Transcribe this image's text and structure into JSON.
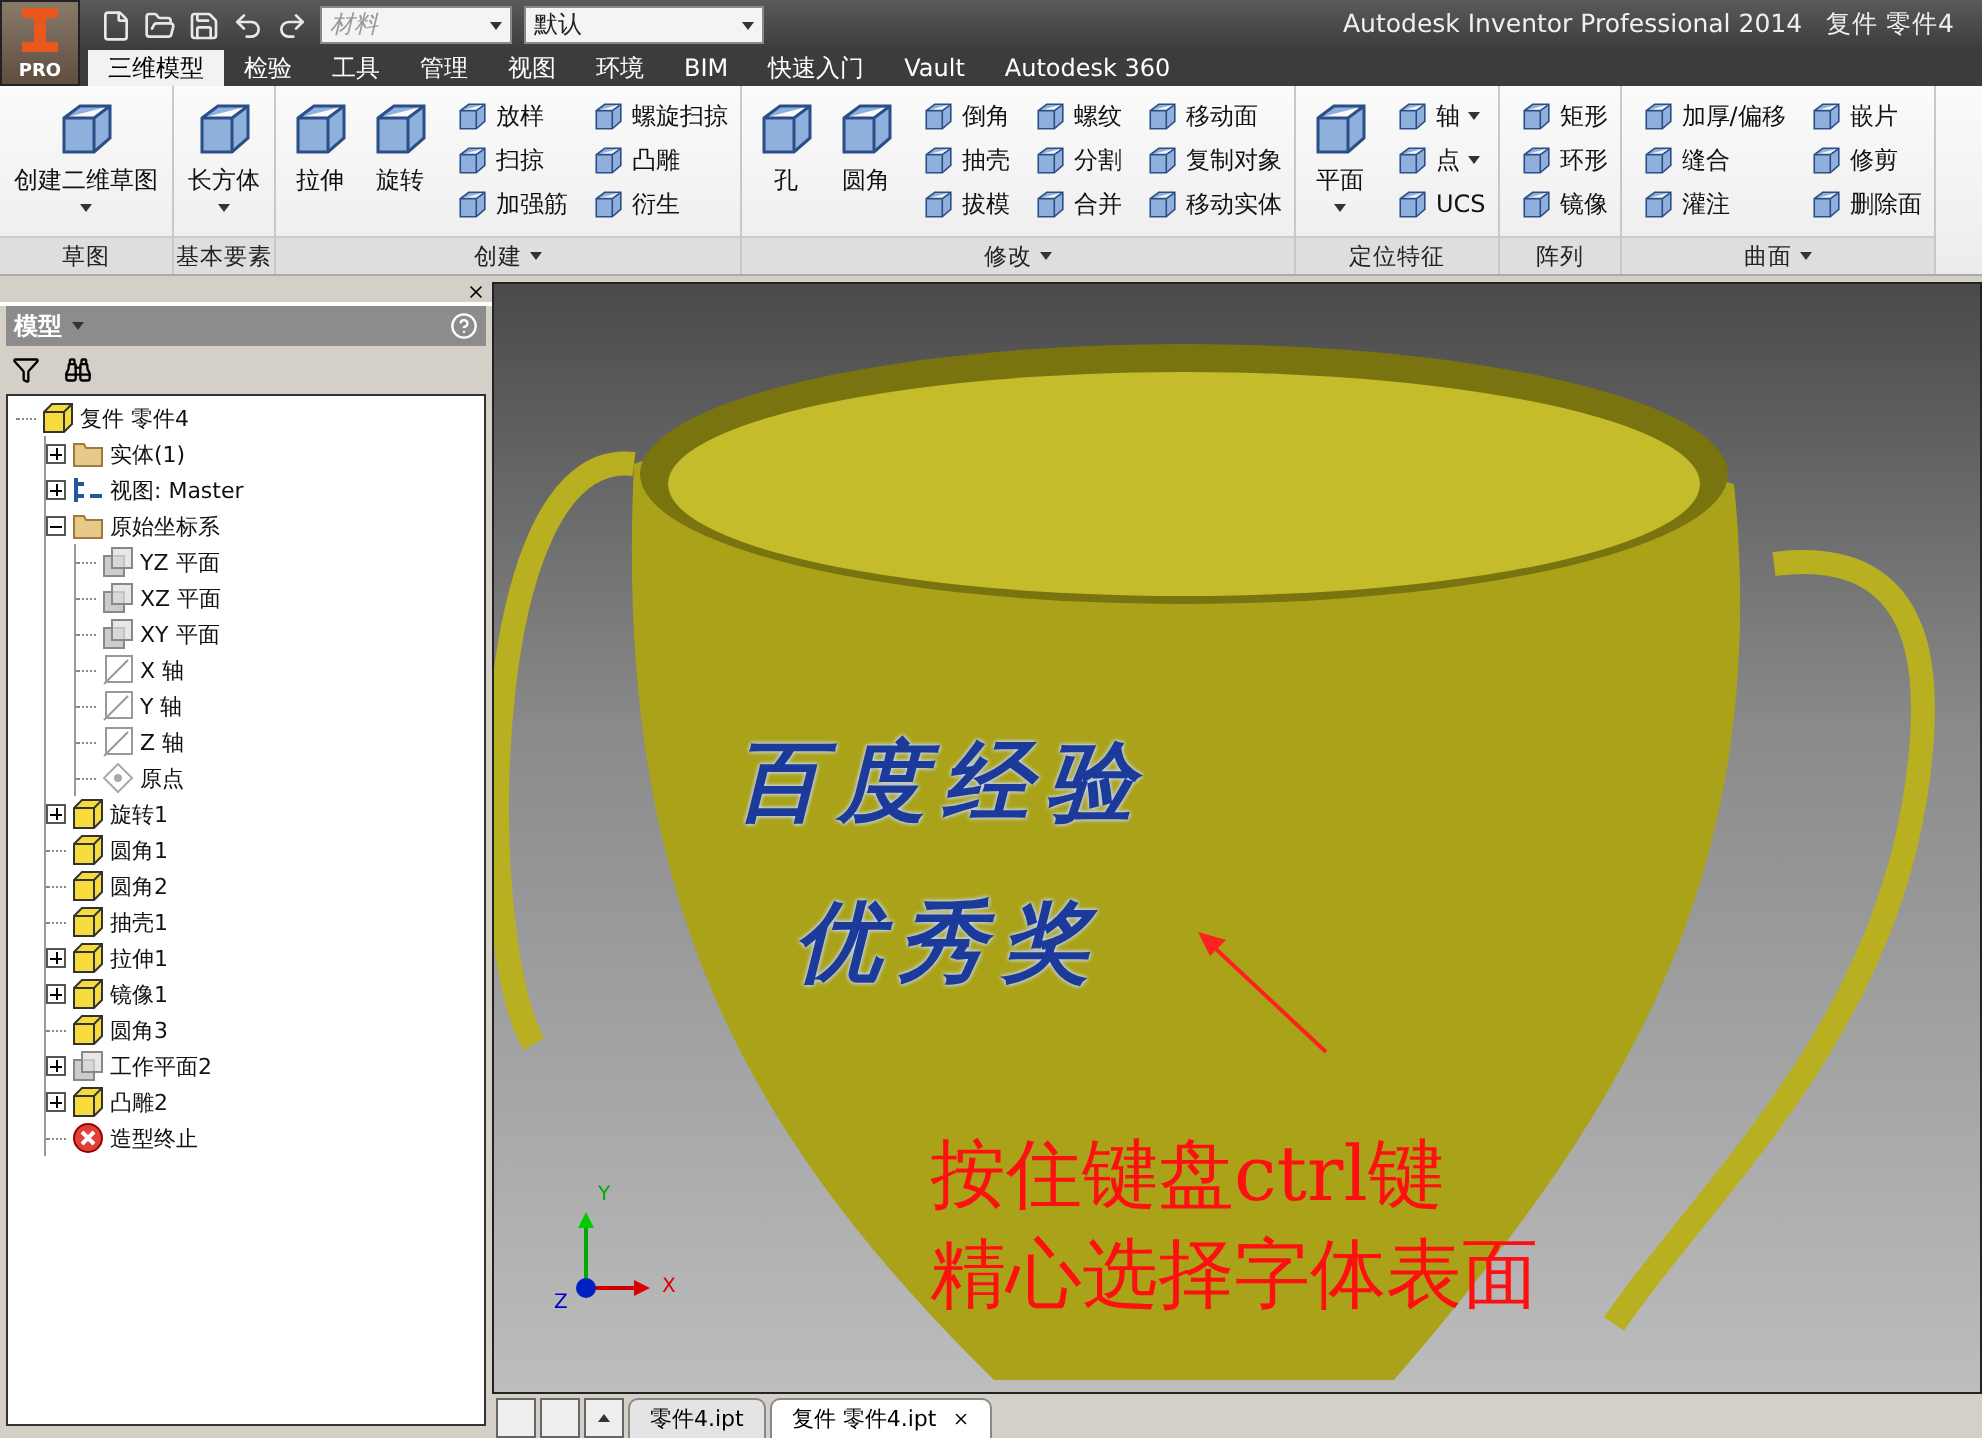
{
  "app_button": {
    "label": "PRO"
  },
  "quick_access": {
    "material_field": {
      "placeholder": "材料"
    },
    "appearance_field": {
      "value": "默认"
    }
  },
  "title": {
    "application": "Autodesk Inventor Professional 2014",
    "document": "复件 零件4"
  },
  "tabs": [
    {
      "label": "三维模型",
      "selected": true
    },
    {
      "label": "检验",
      "selected": false
    },
    {
      "label": "工具",
      "selected": false
    },
    {
      "label": "管理",
      "selected": false
    },
    {
      "label": "视图",
      "selected": false
    },
    {
      "label": "环境",
      "selected": false
    },
    {
      "label": "BIM",
      "selected": false
    },
    {
      "label": "快速入门",
      "selected": false
    },
    {
      "label": "Vault",
      "selected": false
    },
    {
      "label": "Autodesk 360",
      "selected": false
    }
  ],
  "ribbon": [
    {
      "label": "草图",
      "menu": false,
      "tools": [
        {
          "label": "创建二维草图",
          "kind": "large",
          "menu": true
        }
      ]
    },
    {
      "label": "基本要素",
      "menu": false,
      "tools": [
        {
          "label": "长方体",
          "kind": "large",
          "menu": true
        }
      ]
    },
    {
      "label": "创建",
      "menu": true,
      "tools": [
        {
          "label": "拉伸",
          "kind": "large",
          "menu": false
        },
        {
          "label": "旋转",
          "kind": "large",
          "menu": false
        },
        {
          "label": "放样",
          "kind": "small",
          "menu": false
        },
        {
          "label": "扫掠",
          "kind": "small",
          "menu": false
        },
        {
          "label": "加强筋",
          "kind": "small",
          "menu": false
        },
        {
          "label": "螺旋扫掠",
          "kind": "small",
          "menu": false
        },
        {
          "label": "凸雕",
          "kind": "small",
          "menu": false
        },
        {
          "label": "衍生",
          "kind": "small",
          "menu": false
        }
      ]
    },
    {
      "label": "修改",
      "menu": true,
      "tools": [
        {
          "label": "孔",
          "kind": "large",
          "menu": false
        },
        {
          "label": "圆角",
          "kind": "large",
          "menu": false
        },
        {
          "label": "倒角",
          "kind": "small",
          "menu": false
        },
        {
          "label": "抽壳",
          "kind": "small",
          "menu": false
        },
        {
          "label": "拔模",
          "kind": "small",
          "menu": false
        },
        {
          "label": "螺纹",
          "kind": "small",
          "menu": false
        },
        {
          "label": "分割",
          "kind": "small",
          "menu": false
        },
        {
          "label": "合并",
          "kind": "small",
          "menu": false
        },
        {
          "label": "移动面",
          "kind": "small",
          "menu": false
        },
        {
          "label": "复制对象",
          "kind": "small",
          "menu": false
        },
        {
          "label": "移动实体",
          "kind": "small",
          "menu": false
        }
      ]
    },
    {
      "label": "定位特征",
      "menu": false,
      "tools": [
        {
          "label": "平面",
          "kind": "large",
          "menu": true
        },
        {
          "label": "轴",
          "kind": "small",
          "menu": true
        },
        {
          "label": "点",
          "kind": "small",
          "menu": true
        },
        {
          "label": "UCS",
          "kind": "small",
          "menu": false
        }
      ]
    },
    {
      "label": "阵列",
      "menu": false,
      "tools": [
        {
          "label": "矩形",
          "kind": "small",
          "menu": false
        },
        {
          "label": "环形",
          "kind": "small",
          "menu": false
        },
        {
          "label": "镜像",
          "kind": "small",
          "menu": false
        }
      ]
    },
    {
      "label": "曲面",
      "menu": true,
      "tools": [
        {
          "label": "加厚/偏移",
          "kind": "small",
          "menu": false
        },
        {
          "label": "缝合",
          "kind": "small",
          "menu": false
        },
        {
          "label": "灌注",
          "kind": "small",
          "menu": false
        },
        {
          "label": "嵌片",
          "kind": "small",
          "menu": false
        },
        {
          "label": "修剪",
          "kind": "small",
          "menu": false
        },
        {
          "label": "删除面",
          "kind": "small",
          "menu": false
        }
      ]
    }
  ],
  "browser": {
    "title": "模型",
    "tree": [
      {
        "label": "复件 零件4",
        "kind": "part",
        "children": [
          {
            "label": "实体(1)",
            "kind": "folder",
            "expanded": false
          },
          {
            "label": "视图: Master",
            "kind": "view",
            "expanded": false
          },
          {
            "label": "原始坐标系",
            "kind": "folder",
            "expanded": true,
            "children": [
              {
                "label": "YZ 平面",
                "kind": "plane"
              },
              {
                "label": "XZ 平面",
                "kind": "plane"
              },
              {
                "label": "XY 平面",
                "kind": "plane"
              },
              {
                "label": "X 轴",
                "kind": "axis"
              },
              {
                "label": "Y 轴",
                "kind": "axis"
              },
              {
                "label": "Z 轴",
                "kind": "axis"
              },
              {
                "label": "原点",
                "kind": "point"
              }
            ]
          },
          {
            "label": "旋转1",
            "kind": "feature",
            "expanded": false
          },
          {
            "label": "圆角1",
            "kind": "feature"
          },
          {
            "label": "圆角2",
            "kind": "feature"
          },
          {
            "label": "抽壳1",
            "kind": "feature"
          },
          {
            "label": "拉伸1",
            "kind": "feature",
            "expanded": false
          },
          {
            "label": "镜像1",
            "kind": "feature",
            "expanded": false
          },
          {
            "label": "圆角3",
            "kind": "feature"
          },
          {
            "label": "工作平面2",
            "kind": "plane",
            "expanded": false
          },
          {
            "label": "凸雕2",
            "kind": "feature",
            "expanded": false
          },
          {
            "label": "造型终止",
            "kind": "end"
          }
        ]
      }
    ]
  },
  "viewport": {
    "engraved_text": [
      "百度经验",
      "优秀奖"
    ],
    "annotation": [
      "按住键盘ctrl键",
      "精心选择字体表面"
    ],
    "axes": [
      "X",
      "Y",
      "Z"
    ]
  },
  "document_tabs": [
    {
      "label": "零件4.ipt",
      "selected": false
    },
    {
      "label": "复件 零件4.ipt",
      "selected": true
    }
  ]
}
